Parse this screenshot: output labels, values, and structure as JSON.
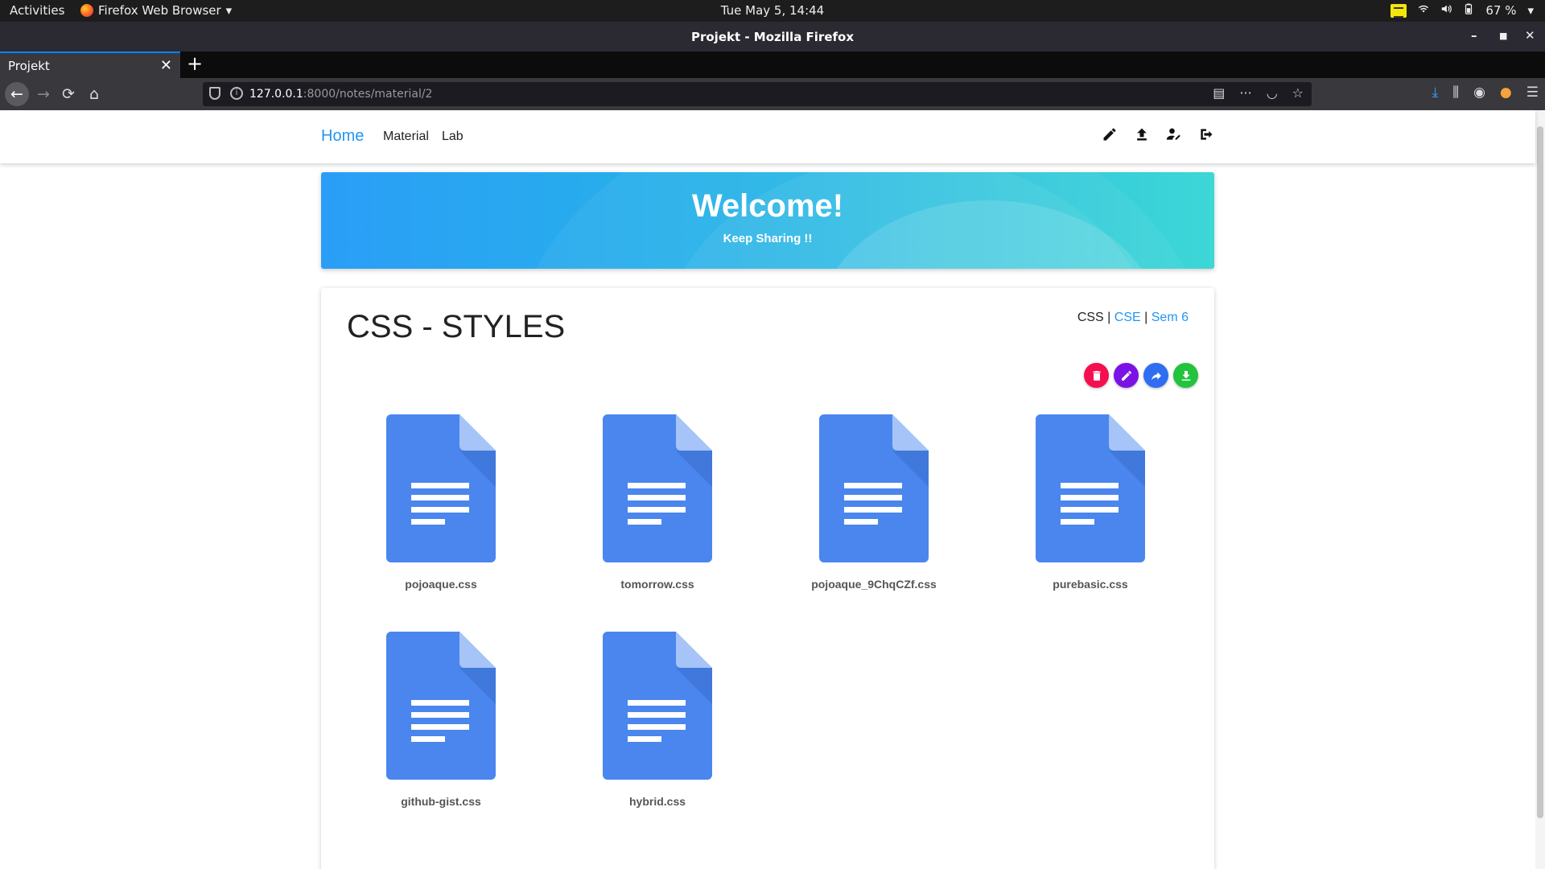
{
  "system": {
    "activities": "Activities",
    "app_menu": "Firefox Web Browser",
    "clock": "Tue May  5, 14:44",
    "battery": "67 %"
  },
  "browser": {
    "window_title": "Projekt - Mozilla Firefox",
    "tab_title": "Projekt",
    "url_host": "127.0.0.1",
    "url_rest": ":8000/notes/material/2"
  },
  "site": {
    "brand": "Home",
    "nav": [
      "Material",
      "Lab"
    ],
    "banner_title": "Welcome!",
    "banner_subtitle": "Keep Sharing !!"
  },
  "material": {
    "title": "CSS - STYLES",
    "tag_plain": "CSS",
    "tag_link1": "CSE",
    "tag_link2": "Sem 6",
    "separator": "|",
    "files": [
      "pojoaque.css",
      "tomorrow.css",
      "pojoaque_9ChqCZf.css",
      "purebasic.css",
      "github-gist.css",
      "hybrid.css"
    ],
    "action_colors": {
      "delete": "#f50f4f",
      "edit": "#7a12e6",
      "share": "#2f6ef2",
      "download": "#22c33d"
    }
  },
  "colors": {
    "accent": "#2196f3",
    "doc_blue": "#4a86ee"
  }
}
